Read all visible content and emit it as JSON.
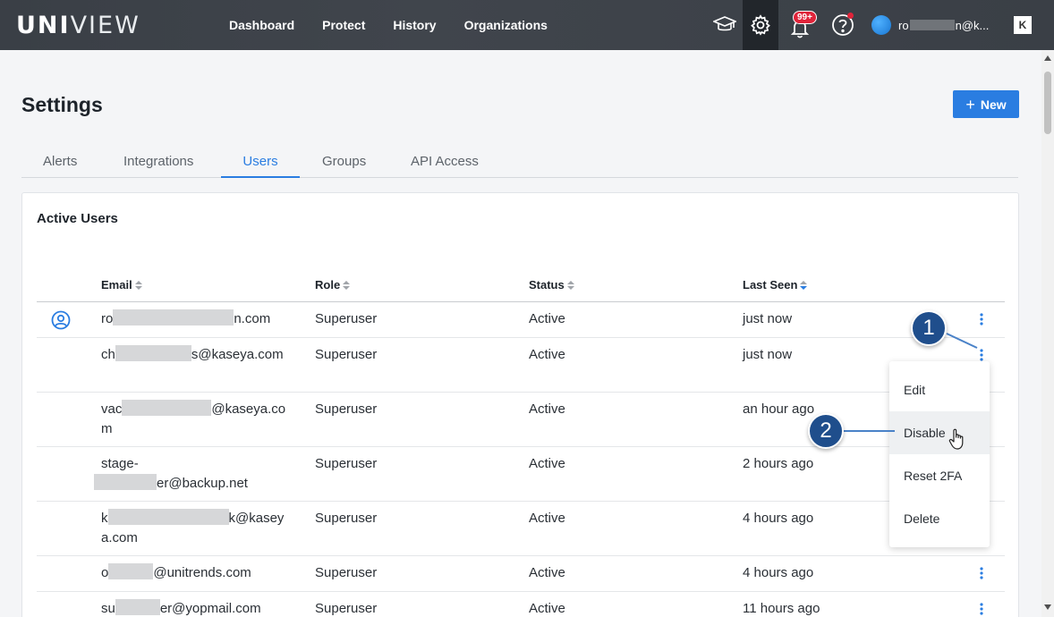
{
  "app": {
    "logo_bold": "UNI",
    "logo_light": "VIEW"
  },
  "nav": {
    "items": [
      "Dashboard",
      "Protect",
      "History",
      "Organizations"
    ]
  },
  "topbar": {
    "notification_badge": "99+",
    "user_prefix": "ro",
    "user_suffix": "n@k..."
  },
  "page": {
    "title": "Settings",
    "new_button": "New"
  },
  "tabs": [
    "Alerts",
    "Integrations",
    "Users",
    "Groups",
    "API Access"
  ],
  "card": {
    "title": "Active Users"
  },
  "table": {
    "headers": {
      "email": "Email",
      "role": "Role",
      "status": "Status",
      "last_seen": "Last Seen"
    },
    "rows": [
      {
        "email_pre": "ro",
        "email_post": "n.com",
        "role": "Superuser",
        "status": "Active",
        "last_seen": "just now"
      },
      {
        "email_pre": "ch",
        "email_post": "s@kaseya.com",
        "role": "Superuser",
        "status": "Active",
        "last_seen": "just now"
      },
      {
        "email_pre": "vac",
        "email_post": "@kaseya.com",
        "role": "Superuser",
        "status": "Active",
        "last_seen": "an hour ago"
      },
      {
        "email_pre": "stage-",
        "email_post": "er@backup.net",
        "role": "Superuser",
        "status": "Active",
        "last_seen": "2 hours ago"
      },
      {
        "email_pre": "k",
        "email_post": "k@kaseya.com",
        "role": "Superuser",
        "status": "Active",
        "last_seen": "4 hours ago"
      },
      {
        "email_pre": "o",
        "email_post": "@unitrends.com",
        "role": "Superuser",
        "status": "Active",
        "last_seen": "4 hours ago"
      },
      {
        "email_pre": "su",
        "email_post": "er@yopmail.com",
        "role": "Superuser",
        "status": "Active",
        "last_seen": "11 hours ago"
      }
    ]
  },
  "menu": {
    "items": [
      "Edit",
      "Disable",
      "Reset 2FA",
      "Delete"
    ]
  },
  "callouts": [
    "1",
    "2"
  ],
  "colors": {
    "accent": "#2a7de1",
    "topbar": "#3a3f46",
    "callout": "#1f4e8c",
    "badge": "#e0243a"
  }
}
